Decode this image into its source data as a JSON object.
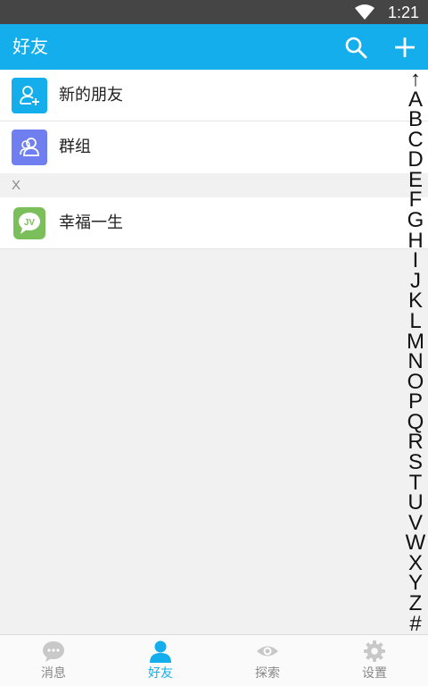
{
  "status_bar": {
    "time": "1:21"
  },
  "app_bar": {
    "title": "好友"
  },
  "quick_items": [
    {
      "label": "新的朋友",
      "icon": "add-friend-icon",
      "color": "#15aeec"
    },
    {
      "label": "群组",
      "icon": "group-icon",
      "color": "#6f7ff0"
    }
  ],
  "section": {
    "header": "X",
    "contacts": [
      {
        "label": "幸福一生",
        "icon": "contact-avatar",
        "color": "#7bbf5a"
      }
    ]
  },
  "index_bar": [
    "↑",
    "A",
    "B",
    "C",
    "D",
    "E",
    "F",
    "G",
    "H",
    "I",
    "J",
    "K",
    "L",
    "M",
    "N",
    "O",
    "P",
    "Q",
    "R",
    "S",
    "T",
    "U",
    "V",
    "W",
    "X",
    "Y",
    "Z",
    "#"
  ],
  "bottom_nav": {
    "active": "好友",
    "tabs": [
      {
        "label": "消息",
        "icon": "chat-icon"
      },
      {
        "label": "好友",
        "icon": "person-icon"
      },
      {
        "label": "探索",
        "icon": "eye-icon"
      },
      {
        "label": "设置",
        "icon": "gear-icon"
      }
    ]
  },
  "colors": {
    "accent": "#15aeec",
    "status_bar": "#454545",
    "inactive": "#c8c8c8"
  }
}
